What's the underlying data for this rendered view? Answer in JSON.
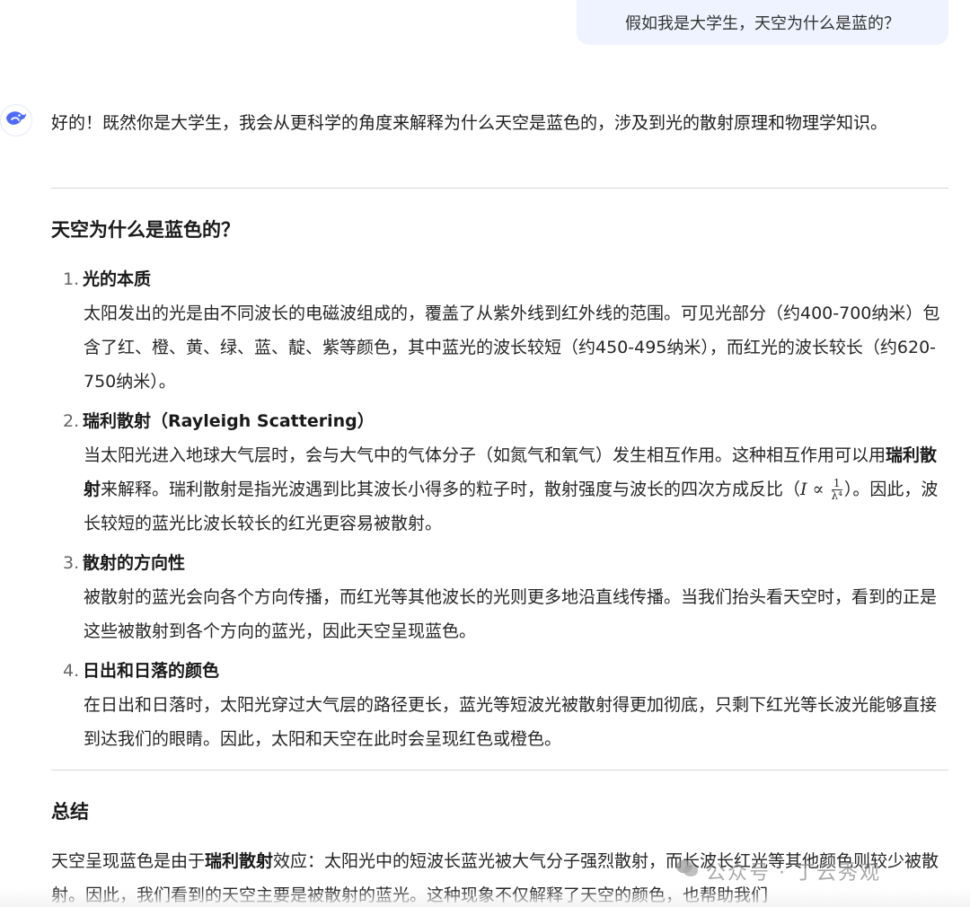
{
  "user_message": "假如我是大学生，天空为什么是蓝的？",
  "assistant": {
    "intro": "好的！既然你是大学生，我会从更科学的角度来解释为什么天空是蓝色的，涉及到光的散射原理和物理学知识。",
    "section1_title": "天空为什么是蓝色的？",
    "items": [
      {
        "num": "1.",
        "title": "光的本质",
        "body": "太阳发出的光是由不同波长的电磁波组成的，覆盖了从紫外线到红外线的范围。可见光部分（约400-700纳米）包含了红、橙、黄、绿、蓝、靛、紫等颜色，其中蓝光的波长较短（约450-495纳米），而红光的波长较长（约620-750纳米）。"
      },
      {
        "num": "2.",
        "title": "瑞利散射（Rayleigh Scattering）",
        "body_a": "当太阳光进入地球大气层时，会与大气中的气体分子（如氮气和氧气）发生相互作用。这种相互作用可以用",
        "body_bold": "瑞利散射",
        "body_b": "来解释。瑞利散射是指光波遇到比其波长小得多的粒子时，散射强度与波长的四次方成反比（",
        "formula_var": "I",
        "formula_op": "∝",
        "formula_num": "1",
        "formula_den": "λ⁴",
        "body_c": "）。因此，波长较短的蓝光比波长较长的红光更容易被散射。"
      },
      {
        "num": "3.",
        "title": "散射的方向性",
        "body": "被散射的蓝光会向各个方向传播，而红光等其他波长的光则更多地沿直线传播。当我们抬头看天空时，看到的正是这些被散射到各个方向的蓝光，因此天空呈现蓝色。"
      },
      {
        "num": "4.",
        "title": "日出和日落的颜色",
        "body": "在日出和日落时，太阳光穿过大气层的路径更长，蓝光等短波光被散射得更加彻底，只剩下红光等长波光能够直接到达我们的眼睛。因此，太阳和天空在此时会呈现红色或橙色。"
      }
    ],
    "section2_title": "总结",
    "summary_a": "天空呈现蓝色是由于",
    "summary_bold": "瑞利散射",
    "summary_b": "效应：太阳光中的短波长蓝光被大气分子强烈散射，而长波长红光等其他颜色则较少被散射。因此，我们看到的天空主要是被散射的蓝光。这种现象不仅解释了天空的颜色，也帮助我们"
  },
  "watermark_text": "公众号 · 丁云秀观",
  "colors": {
    "user_bubble": "#eef3ff",
    "logo_blue": "#4d6bfe"
  },
  "icons": {
    "avatar": "deepseek-whale-icon",
    "watermark": "wechat-icon"
  }
}
